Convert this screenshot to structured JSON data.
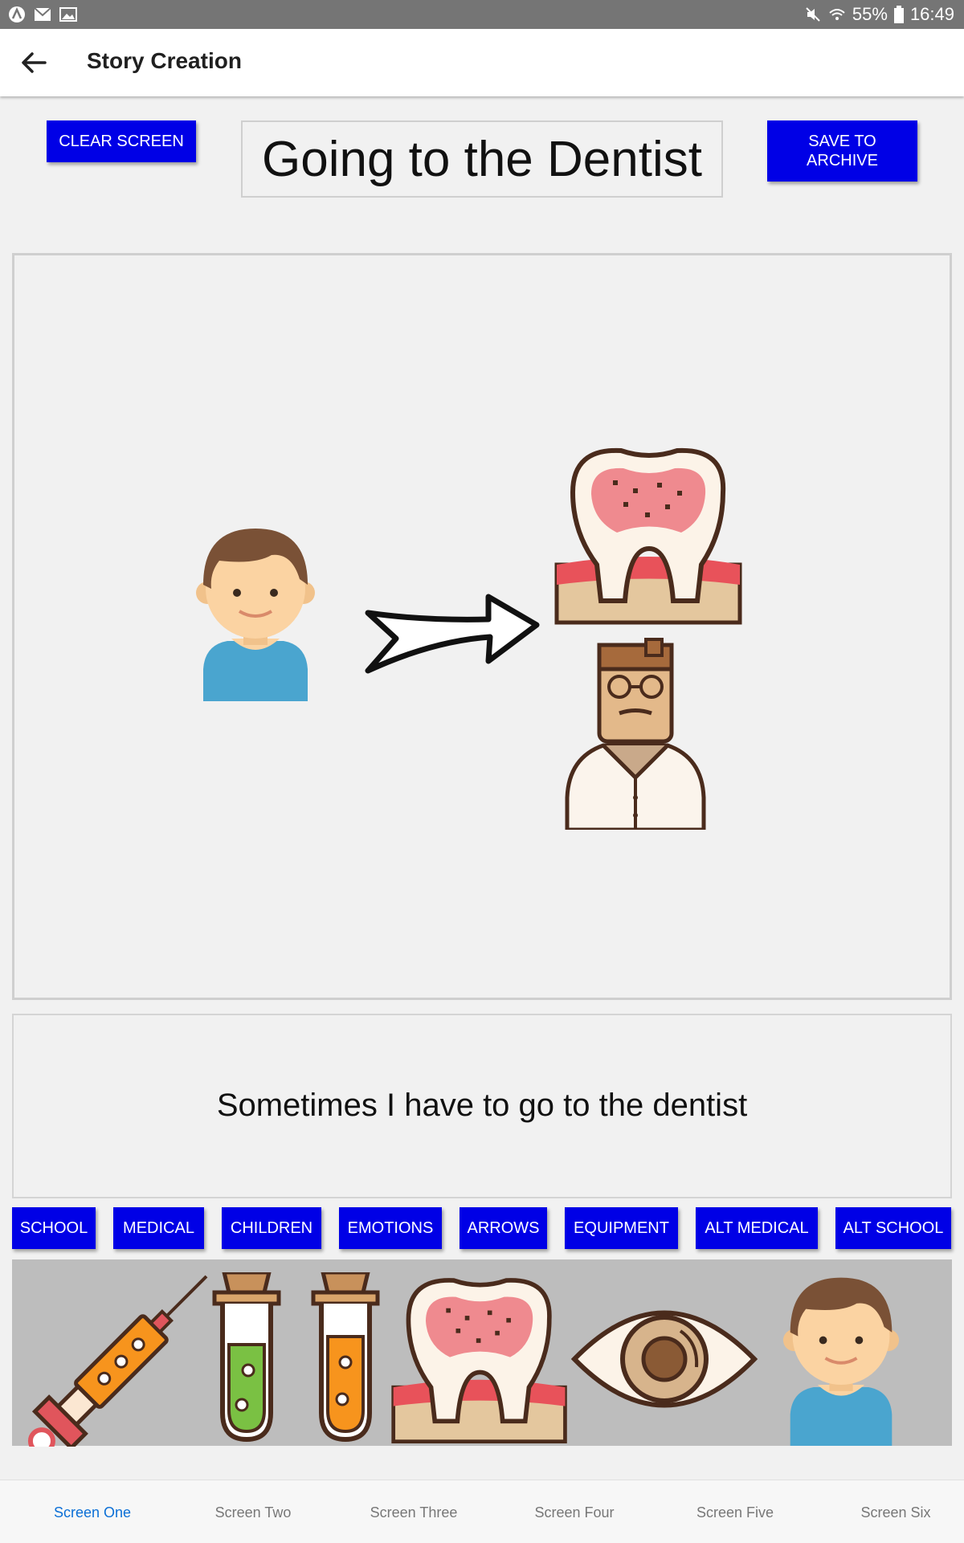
{
  "status_bar": {
    "battery": "55%",
    "time": "16:49",
    "icons": [
      "app-icon",
      "mail-icon",
      "image-icon",
      "mute-icon",
      "wifi-icon",
      "battery-icon"
    ]
  },
  "app_bar": {
    "title": "Story Creation",
    "back_icon": "back-arrow-icon"
  },
  "toolbar": {
    "clear_label": "CLEAR SCREEN",
    "save_label": "SAVE TO ARCHIVE",
    "story_title": "Going to the Dentist"
  },
  "canvas": {
    "items": [
      "boy-icon",
      "arrow-icon",
      "tooth-icon",
      "dentist-icon"
    ]
  },
  "caption": "Sometimes I have to go to the dentist",
  "categories": [
    "SCHOOL",
    "MEDICAL",
    "CHILDREN",
    "EMOTIONS",
    "ARROWS",
    "EQUIPMENT",
    "ALT MEDICAL",
    "ALT SCHOOL"
  ],
  "palette": {
    "items": [
      "syringe-icon",
      "test-tube-green-icon",
      "test-tube-orange-icon",
      "tooth-icon",
      "eye-icon",
      "boy-icon"
    ]
  },
  "tabs": {
    "items": [
      "Screen One",
      "Screen Two",
      "Screen Three",
      "Screen Four",
      "Screen Five",
      "Screen Six"
    ],
    "active": "Screen One"
  },
  "colors": {
    "button": "#0000e6",
    "active_tab": "#0b6fd6",
    "palette_bg": "#bdbdbd"
  }
}
